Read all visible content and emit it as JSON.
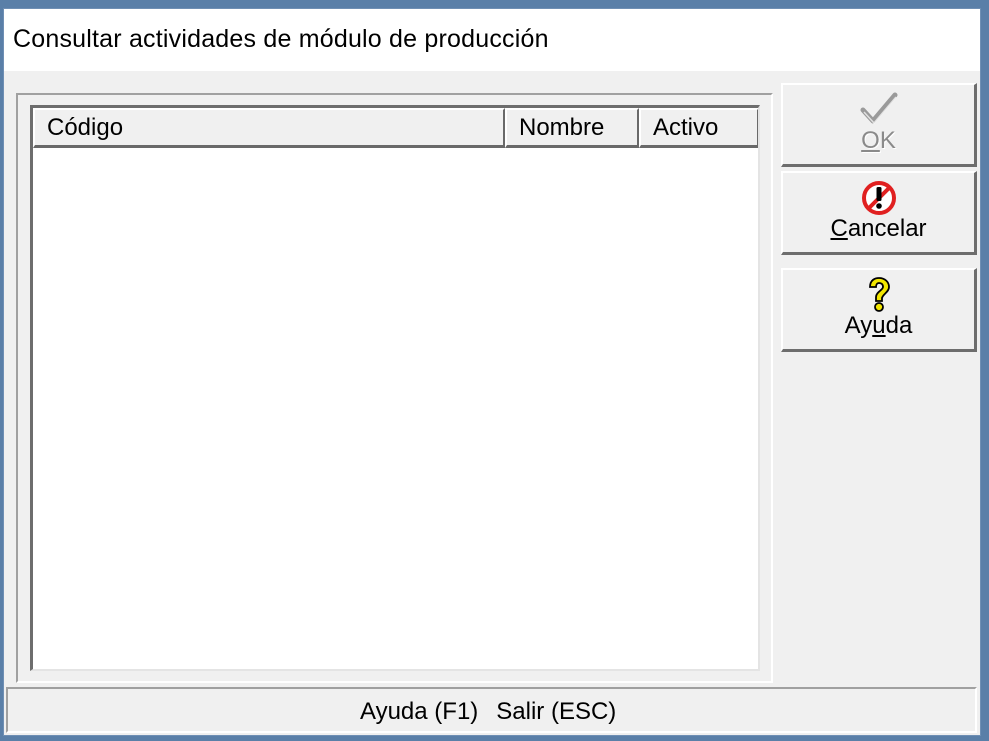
{
  "window": {
    "title": "Consultar actividades de módulo de producción"
  },
  "list": {
    "columns": [
      "Código",
      "Nombre",
      "Activo"
    ],
    "rows": []
  },
  "buttons": {
    "ok": {
      "prefix": "",
      "mnemonic": "O",
      "suffix": "K",
      "icon": "checkmark-icon",
      "enabled": false
    },
    "cancel": {
      "prefix": "",
      "mnemonic": "C",
      "suffix": "ancelar",
      "icon": "cancel-icon"
    },
    "help": {
      "prefix": "Ay",
      "mnemonic": "u",
      "suffix": "da",
      "icon": "help-icon"
    }
  },
  "status": {
    "help_hint": "Ayuda (F1)",
    "exit_hint": "Salir (ESC)"
  },
  "colors": {
    "background": "#f0f0f0",
    "titlebar": "#ffffff",
    "cancel_icon": "#e02020",
    "help_icon": "#f2e600"
  }
}
